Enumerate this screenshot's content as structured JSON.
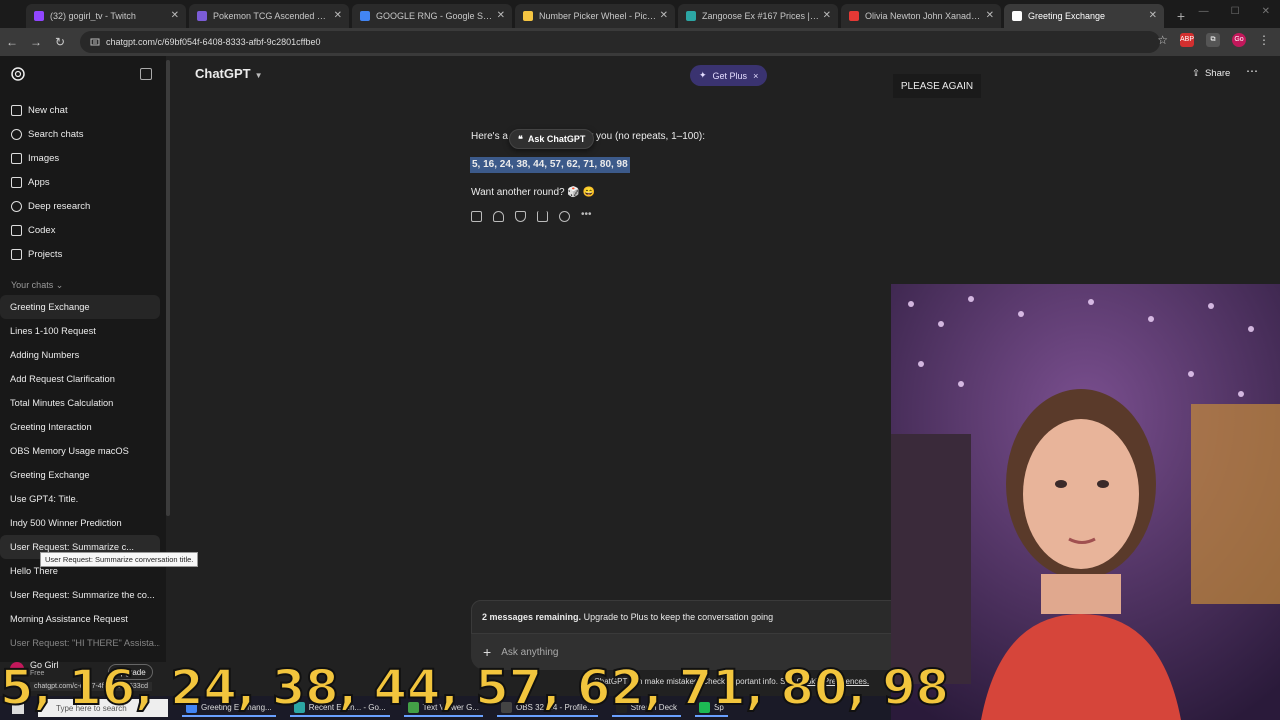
{
  "browser": {
    "tabs": [
      {
        "label": "(32) gogirl_tv - Twitch",
        "color": "#9146ff",
        "active": false
      },
      {
        "label": "Pokemon TCG Ascended Heroe",
        "color": "#7b5cd6",
        "active": false
      },
      {
        "label": "GOOGLE RNG - Google Search",
        "color": "#4285f4",
        "active": false
      },
      {
        "label": "Number Picker Wheel - Pick Ra",
        "color": "#f5c542",
        "active": false
      },
      {
        "label": "Zangoose Ex #167 Prices | Poke",
        "color": "#2ca6a4",
        "active": false
      },
      {
        "label": "Olivia Newton John Xanadu Or",
        "color": "#e53935",
        "active": false
      },
      {
        "label": "Greeting Exchange",
        "color": "#ffffff",
        "active": true
      }
    ],
    "url": "chatgpt.com/c/69bf054f-6408-8333-afbf-9c2801cffbe0",
    "extensions": [
      {
        "label": "ABP",
        "color": "#d32f2f"
      },
      {
        "label": "",
        "color": "#555555"
      },
      {
        "label": "Go",
        "color": "#c2185b"
      }
    ]
  },
  "sidebar": {
    "nav": [
      {
        "label": "New chat",
        "icon": "edit-icon"
      },
      {
        "label": "Search chats",
        "icon": "search-icon"
      },
      {
        "label": "Images",
        "icon": "image-icon"
      },
      {
        "label": "Apps",
        "icon": "apps-icon"
      },
      {
        "label": "Deep research",
        "icon": "telescope-icon"
      },
      {
        "label": "Codex",
        "icon": "code-icon"
      },
      {
        "label": "Projects",
        "icon": "folder-icon"
      }
    ],
    "section_label": "Your chats",
    "chats": [
      "Greeting Exchange",
      "Lines 1-100 Request",
      "Adding Numbers",
      "Add Request Clarification",
      "Total Minutes Calculation",
      "Greeting Interaction",
      "OBS Memory Usage macOS",
      "Greeting Exchange",
      "Use GPT4: Title.",
      "Indy 500 Winner Prediction",
      "User Request: Summarize c...",
      "Hello There",
      "User Request: Summarize the co...",
      "Morning Assistance Request",
      "User Request: \"HI THERE\" Assista..."
    ],
    "tooltip": "User Request: Summarize conversation title.",
    "profile_name": "Go Girl",
    "profile_plan": "Free",
    "upgrade_label": "Upgrade"
  },
  "header": {
    "title": "ChatGPT",
    "get_plus": "Get Plus",
    "share": "Share",
    "please_again": "PLEASE AGAIN"
  },
  "message": {
    "intro_start": "Here's a",
    "intro_end": "r you (no repeats, 1–100):",
    "ask_chatgpt": "Ask ChatGPT",
    "numbers": "5, 16, 24, 38, 44, 57, 62, 71, 80, 98",
    "followup": "Want another round? 🎲 😄"
  },
  "composer": {
    "banner_bold": "2 messages remaining.",
    "banner_text": " Upgrade to Plus to keep the conversation going",
    "placeholder": "Ask anything"
  },
  "overlay": {
    "numbers": "5, 16, 24, 38, 44, 57, 62, 71, 80, 98"
  },
  "status_url": "chatgpt.com/c-d947-4f26...605533cd",
  "cookie_text": "ChatGPT can make mistakes. Check important info. See ",
  "cookie_link": "Cookie Preferences.",
  "taskbar": {
    "search": "Type here to search",
    "items": [
      {
        "label": "Greeting Exchang...",
        "color": "#4285f4"
      },
      {
        "label": "Recent Even... - Go...",
        "color": "#2ca6a4"
      },
      {
        "label": "Text Viewer G...",
        "color": "#43a047"
      },
      {
        "label": "OBS 32.0.4 - Profile...",
        "color": "#444444"
      },
      {
        "label": "Stream Deck",
        "color": "#222222"
      },
      {
        "label": "Sp",
        "color": "#1db954"
      }
    ]
  }
}
